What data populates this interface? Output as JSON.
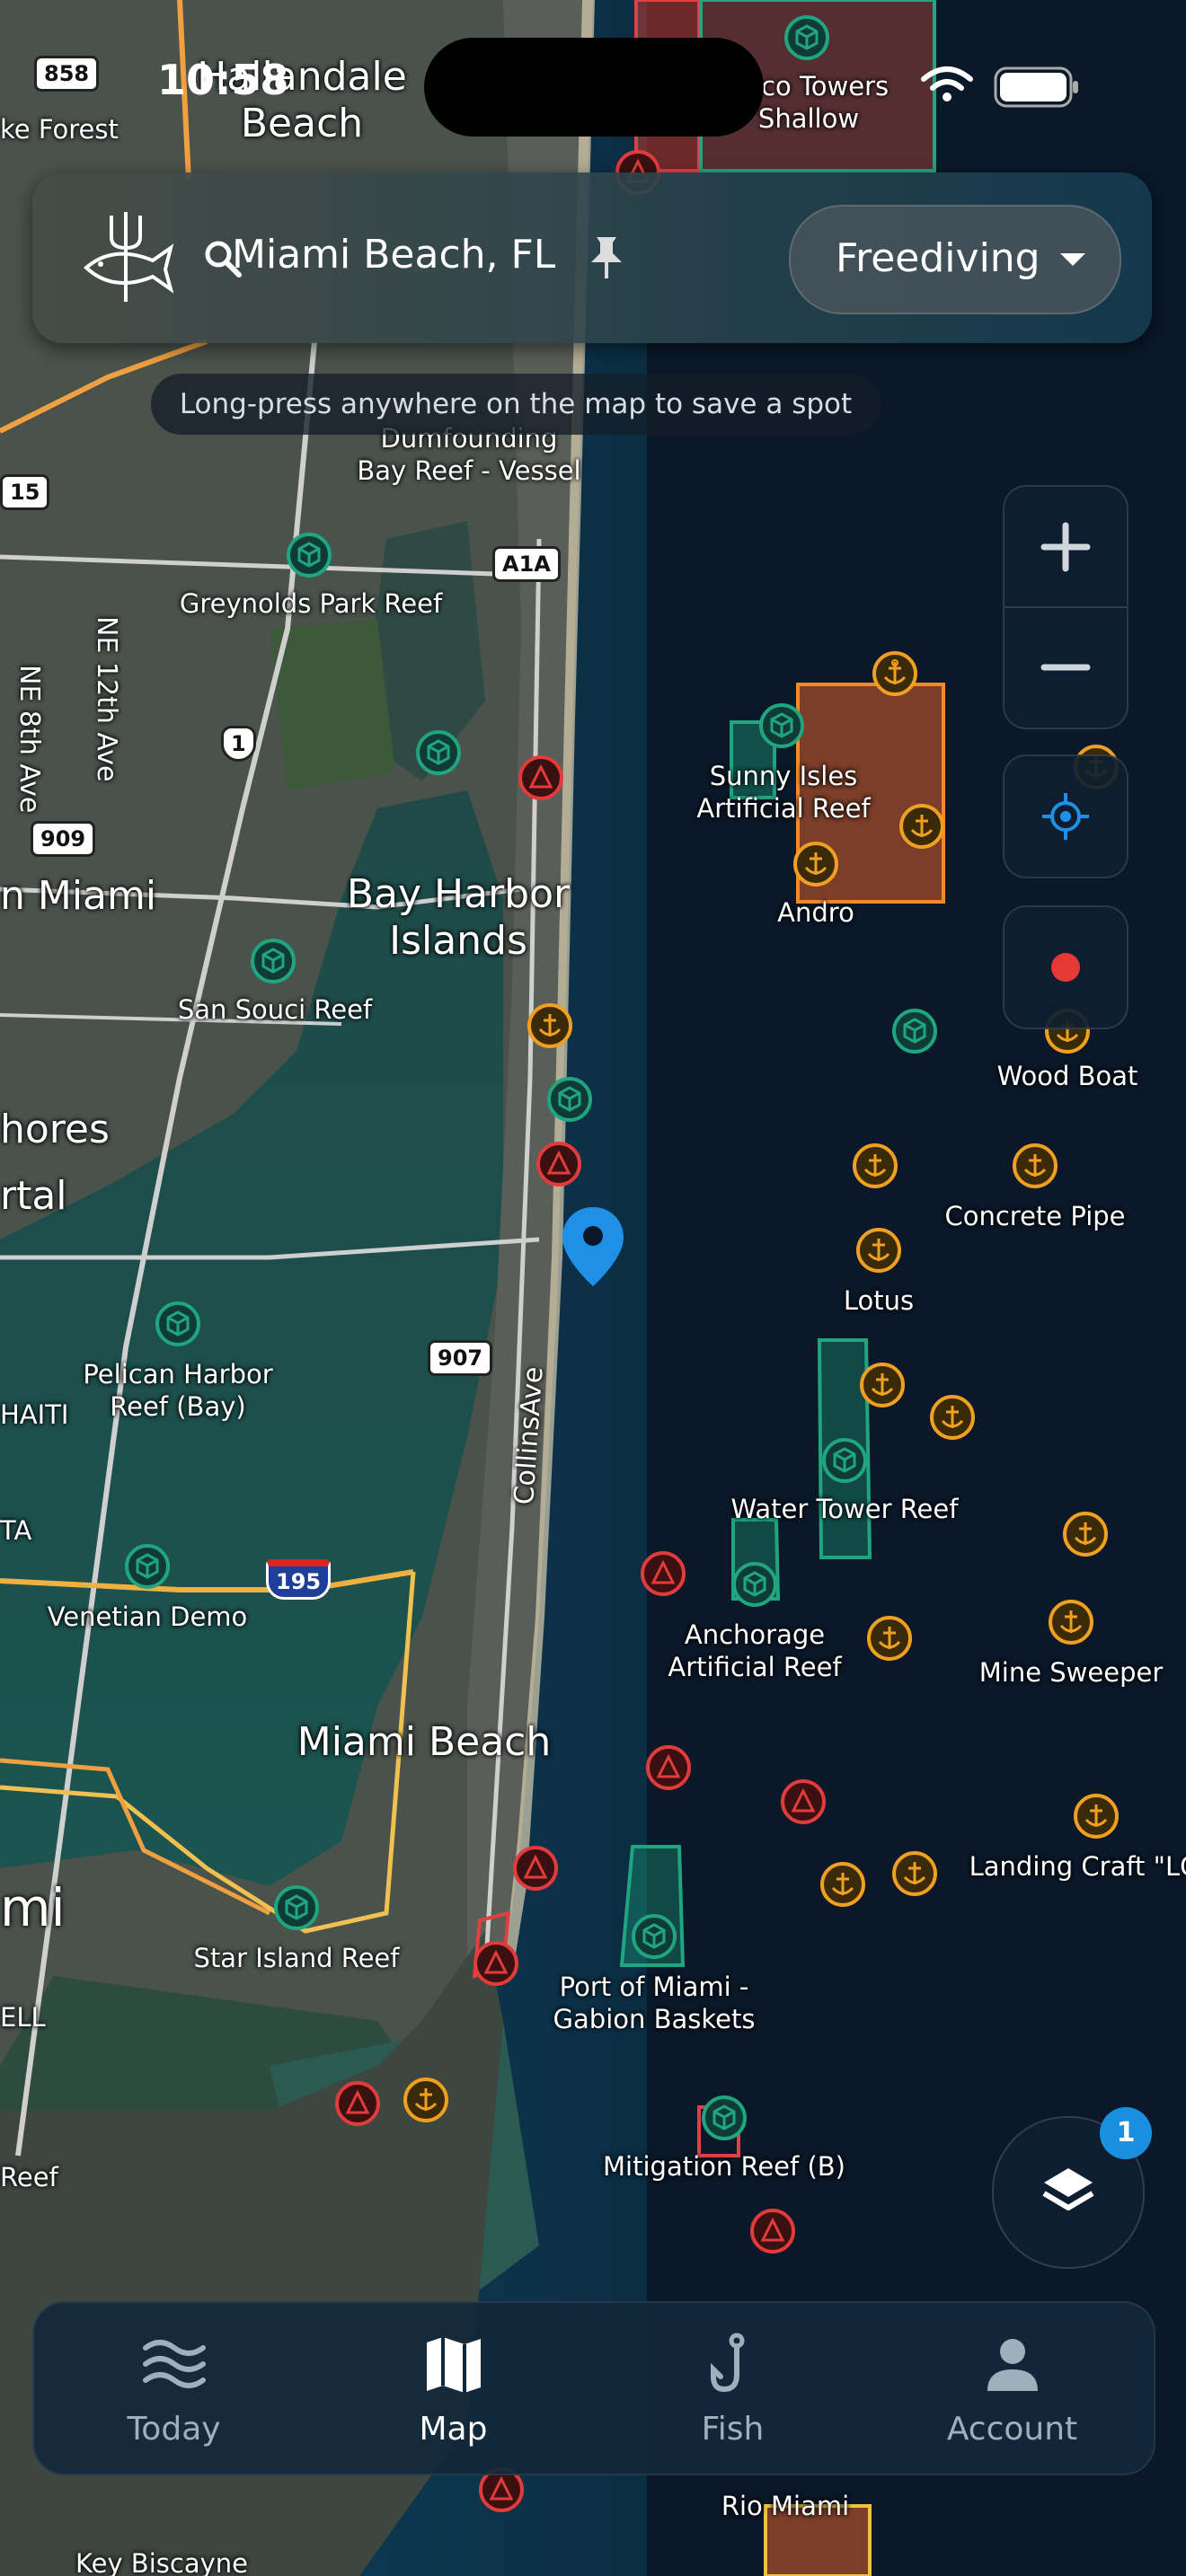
{
  "status_bar": {
    "time": "10:58"
  },
  "search": {
    "location": "Miami Beach, FL",
    "activity": "Freediving"
  },
  "hint": "Long-press anywhere on the map to save a spot",
  "layers": {
    "badge_count": "1"
  },
  "nav": {
    "items": [
      {
        "label": "Today",
        "icon": "waves-icon"
      },
      {
        "label": "Map",
        "icon": "map-icon",
        "active": true
      },
      {
        "label": "Fish",
        "icon": "hook-icon"
      },
      {
        "label": "Account",
        "icon": "person-icon"
      }
    ]
  },
  "colors": {
    "reef": "#1fa57f",
    "wreck": "#f0a020",
    "hazard": "#e23b3b",
    "pin": "#1e90e6",
    "record": "#e53935",
    "badge": "#1a8fe0"
  },
  "map": {
    "place_labels": {
      "hallandale_beach": "Hallandale\nBeach",
      "lake_forest": "ke Forest",
      "bay_harbor_islands": "Bay Harbor\nIslands",
      "north_miami": "n Miami",
      "shores": "hores",
      "rtal": "rtal",
      "haiti": "HAITI",
      "ta": "TA",
      "miami_beach": "Miami Beach",
      "mi": "mi",
      "ell": "ELL",
      "key_biscayne": "Key Biscayne"
    },
    "road_labels": {
      "r858": "858",
      "r15": "15",
      "r909": "909",
      "r1": "1",
      "r907": "907",
      "a1a": "A1A",
      "i195": "195",
      "ne_8th": "NE 8th Ave",
      "ne_12th": "NE 12th Ave",
      "collins": "CollinsAve"
    },
    "spot_labels": {
      "oneco": "neco Towers\nShallow",
      "dumfounding": "Dumfounding\nBay Reef - Vessel",
      "greynolds": "Greynolds Park Reef",
      "sunny_isles": "Sunny Isles\nArtificial Reef",
      "andro": "Andro",
      "san_souci": "San Souci Reef",
      "wood_boat": "Wood Boat",
      "concrete_pipe": "Concrete Pipe",
      "lotus": "Lotus",
      "pelican": "Pelican Harbor\nReef (Bay)",
      "water_tower": "Water Tower Reef",
      "anchorage": "Anchorage\nArtificial Reef",
      "mine_sweeper": "Mine Sweeper",
      "venetian": "Venetian Demo",
      "landing_craft": "Landing Craft \"LC",
      "star_island": "Star Island Reef",
      "port_miami": "Port of Miami -\nGabion Baskets",
      "mitigation": "Mitigation Reef (B)",
      "reef_left": "Reef",
      "rio_miami": "Rio Miami"
    }
  }
}
